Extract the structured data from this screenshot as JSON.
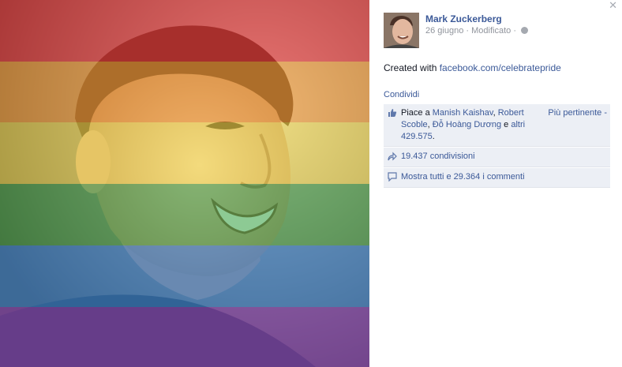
{
  "post": {
    "author": "Mark Zuckerberg",
    "date": "26 giugno",
    "sep": "·",
    "edited": "Modificato",
    "caption_text": "Created with ",
    "caption_link": "facebook.com/celebratepride"
  },
  "actions": {
    "share": "Condividi"
  },
  "likes": {
    "prefix": "Piace a ",
    "name1": "Manish Kaishav",
    "comma": ", ",
    "name2": "Robert Scoble",
    "name3": "Đỗ Hoàng Dương",
    "conj": " e ",
    "others": "altri 429.575",
    "end": ".",
    "sort": "Più pertinente -"
  },
  "shares": {
    "label": "19.437 condivisioni"
  },
  "comments": {
    "label": "Mostra tutti e 29.364 i commenti"
  },
  "icons": {
    "close": "close-icon",
    "globe": "globe-icon",
    "like": "thumbs-up-icon",
    "share": "share-arrow-icon",
    "comment": "comment-bubble-icon"
  },
  "colors": {
    "link": "#3b5998",
    "ufi_bg": "#eceff5",
    "rainbow": [
      "#e7252a",
      "#f29727",
      "#f4e23b",
      "#2f9e3d",
      "#2a7fd0",
      "#7d3fb0"
    ]
  }
}
